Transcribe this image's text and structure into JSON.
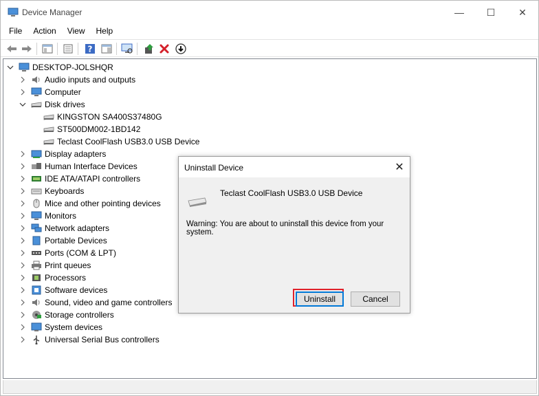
{
  "window": {
    "title": "Device Manager",
    "minimize_glyph": "—",
    "maximize_glyph": "☐",
    "close_glyph": "✕"
  },
  "menu": [
    "File",
    "Action",
    "View",
    "Help"
  ],
  "toolbar": {
    "icons": [
      "back-icon",
      "forward-icon",
      "show-hide-icon",
      "properties-icon",
      "help-icon",
      "action-pane-icon",
      "scan-hardware-icon",
      "update-driver-icon",
      "uninstall-icon",
      "disable-device-icon"
    ]
  },
  "tree": {
    "root": "DESKTOP-JOLSHQR",
    "categories": [
      {
        "label": "Audio inputs and outputs",
        "icon": "speaker-icon",
        "expanded": false
      },
      {
        "label": "Computer",
        "icon": "monitor-icon",
        "expanded": false
      },
      {
        "label": "Disk drives",
        "icon": "drive-icon",
        "expanded": true,
        "children": [
          "KINGSTON SA400S37480G",
          "ST500DM002-1BD142",
          "Teclast CoolFlash USB3.0 USB Device"
        ]
      },
      {
        "label": "Display adapters",
        "icon": "display-adapter-icon",
        "expanded": false
      },
      {
        "label": "Human Interface Devices",
        "icon": "hid-icon",
        "expanded": false
      },
      {
        "label": "IDE ATA/ATAPI controllers",
        "icon": "ide-icon",
        "expanded": false
      },
      {
        "label": "Keyboards",
        "icon": "keyboard-icon",
        "expanded": false
      },
      {
        "label": "Mice and other pointing devices",
        "icon": "mouse-icon",
        "expanded": false
      },
      {
        "label": "Monitors",
        "icon": "monitor-icon",
        "expanded": false
      },
      {
        "label": "Network adapters",
        "icon": "network-icon",
        "expanded": false
      },
      {
        "label": "Portable Devices",
        "icon": "portable-device-icon",
        "expanded": false
      },
      {
        "label": "Ports (COM & LPT)",
        "icon": "port-icon",
        "expanded": false
      },
      {
        "label": "Print queues",
        "icon": "printer-icon",
        "expanded": false
      },
      {
        "label": "Processors",
        "icon": "processor-icon",
        "expanded": false
      },
      {
        "label": "Software devices",
        "icon": "software-device-icon",
        "expanded": false
      },
      {
        "label": "Sound, video and game controllers",
        "icon": "speaker-icon",
        "expanded": false
      },
      {
        "label": "Storage controllers",
        "icon": "storage-controller-icon",
        "expanded": false
      },
      {
        "label": "System devices",
        "icon": "system-device-icon",
        "expanded": false
      },
      {
        "label": "Universal Serial Bus controllers",
        "icon": "usb-icon",
        "expanded": false
      }
    ]
  },
  "dialog": {
    "title": "Uninstall Device",
    "device_name": "Teclast CoolFlash USB3.0 USB Device",
    "warning": "Warning: You are about to uninstall this device from your system.",
    "uninstall_label": "Uninstall",
    "cancel_label": "Cancel",
    "highlight_color": "#e0202a"
  }
}
